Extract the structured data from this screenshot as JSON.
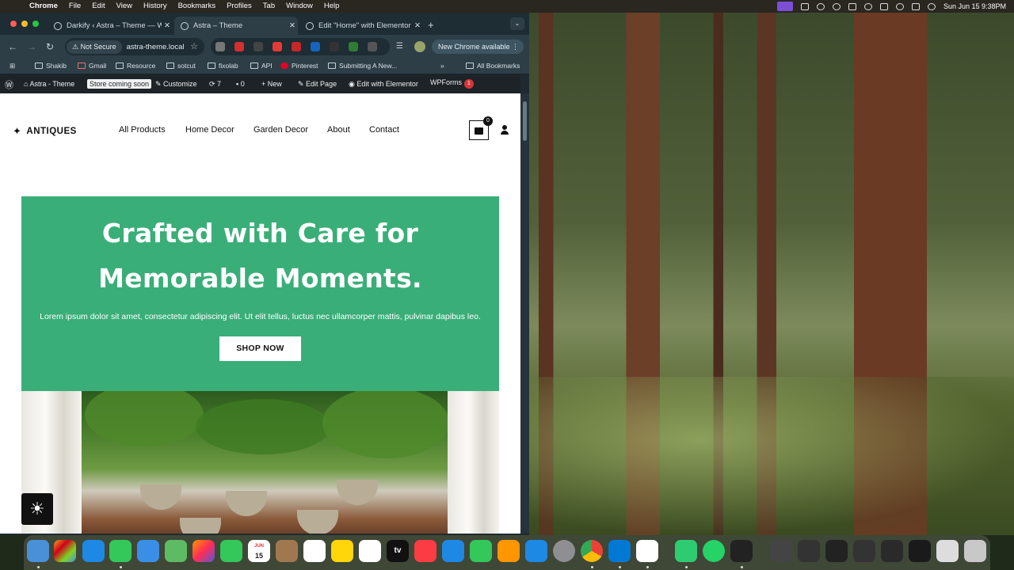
{
  "menubar": {
    "app": "Chrome",
    "items": [
      "File",
      "Edit",
      "View",
      "History",
      "Bookmarks",
      "Profiles",
      "Tab",
      "Window",
      "Help"
    ],
    "datetime": "Sun Jun 15  9:38PM"
  },
  "browser": {
    "tabs": [
      {
        "title": "Darkify ‹ Astra – Theme — W"
      },
      {
        "title": "Astra – Theme"
      },
      {
        "title": "Edit \"Home\" with Elementor"
      }
    ],
    "address": {
      "security": "Not Secure",
      "url": "astra-theme.local"
    },
    "new_chrome": "New Chrome available",
    "bookmarks": [
      "Shakib",
      "Gmail",
      "Resource",
      "sotcut",
      "fixolab",
      "API",
      "Pinterest",
      "Submitting A New..."
    ],
    "all_bookmarks": "All Bookmarks",
    "bookmarks_overflow": "»"
  },
  "wp_admin_bar": {
    "site_name": "Astra - Theme",
    "store_badge": "Store coming soon",
    "customize": "Customize",
    "updates_count": "7",
    "comments_count": "0",
    "new": "New",
    "edit_page": "Edit Page",
    "edit_elementor": "Edit with Elementor",
    "wpforms": "WPForms",
    "wpforms_count": "1"
  },
  "site": {
    "logo": "ANTIQUES",
    "nav": [
      "All Products",
      "Home Decor",
      "Garden Decor",
      "About",
      "Contact"
    ],
    "cart_count": "0",
    "hero": {
      "line1": "Crafted with Care for",
      "line2": "Memorable Moments.",
      "text": "Lorem ipsum dolor sit amet, consectetur adipiscing elit. Ut elit tellus, luctus nec ullamcorper mattis, pulvinar dapibus leo.",
      "button": "SHOP NOW",
      "bg_color": "#3aae78"
    }
  },
  "dock": {
    "calendar_month": "JUN",
    "calendar_day": "15",
    "tv_label": "tv"
  }
}
